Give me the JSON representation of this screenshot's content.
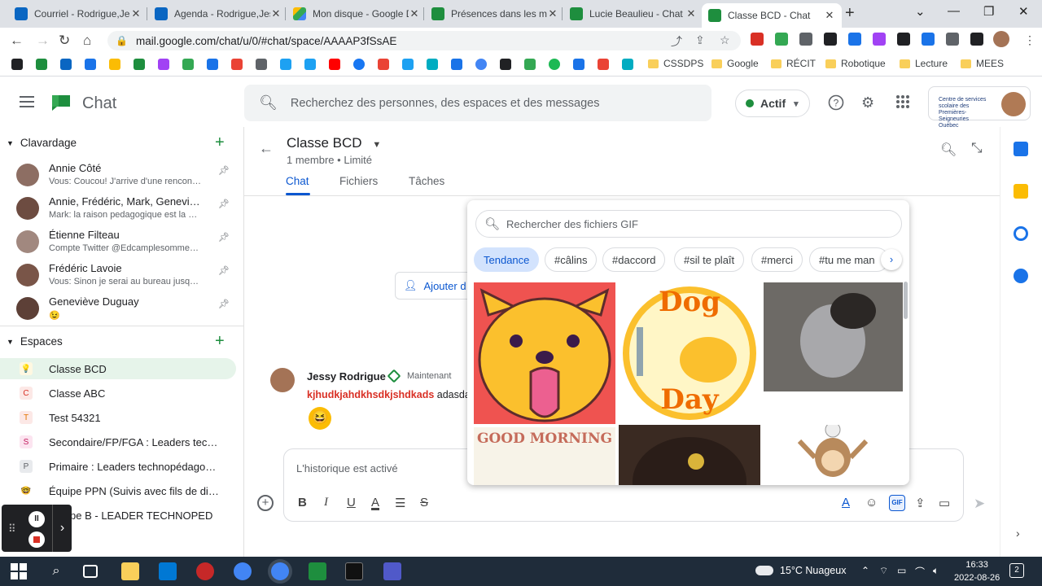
{
  "browser": {
    "tabs": [
      {
        "title": "Courriel - Rodrigue,Jes",
        "color": "#0a66c2"
      },
      {
        "title": "Agenda - Rodrigue,Jess",
        "color": "#0a66c2"
      },
      {
        "title": "Mon disque - Google D",
        "color": "#fbbc04"
      },
      {
        "title": "Présences dans les mi",
        "color": "#1e8e3e"
      },
      {
        "title": "Lucie Beaulieu - Chat",
        "color": "#1e8e3e"
      },
      {
        "title": "Classe BCD - Chat",
        "color": "#1e8e3e"
      }
    ],
    "new_tab": "+",
    "window_buttons": [
      "⌄",
      "—",
      "❐",
      "✕"
    ],
    "url": "mail.google.com/chat/u/0/#chat/space/AAAAP3fSsAE",
    "bookmark_folders": [
      "CSSDPS",
      "Google",
      "RÉCIT",
      "Robotique",
      "Lecture",
      "MEES"
    ]
  },
  "app": {
    "title": "Chat",
    "search_placeholder": "Recherchez des personnes, des espaces et des messages",
    "status": "Actif",
    "status_caret": "▾",
    "org_name": "Centre de services scolaire des Premières-Seigneuries Québec"
  },
  "sidebar": {
    "dm_header": "Clavardage",
    "dms": [
      {
        "name": "Annie Côté",
        "preview": "Vous: Coucou! J'arrive d'une rencon…",
        "color": "#8d6e63"
      },
      {
        "name": "Annie, Frédéric, Mark, Genevi…",
        "preview": "Mark: la raison pedagogique est la …",
        "color": "#6d4c41"
      },
      {
        "name": "Étienne Filteau",
        "preview": "Compte Twitter @Edcamplesomme…",
        "color": "#a1887f"
      },
      {
        "name": "Frédéric Lavoie",
        "preview": "Vous: Sinon je serai au bureau jusq…",
        "color": "#795548"
      },
      {
        "name": "Geneviève Duguay",
        "preview": "😉",
        "color": "#5d4037"
      }
    ],
    "spaces_header": "Espaces",
    "spaces": [
      {
        "label": "Classe BCD",
        "icon": "💡",
        "bg": "#fff8e1",
        "fg": "#f9ab00"
      },
      {
        "label": "Classe ABC",
        "icon": "C",
        "bg": "#fce8e6",
        "fg": "#d93025"
      },
      {
        "label": "Test 54321",
        "icon": "T",
        "bg": "#fce8e6",
        "fg": "#e37400"
      },
      {
        "label": "Secondaire/FP/FGA : Leaders tec…",
        "icon": "S",
        "bg": "#fce4f0",
        "fg": "#c2185b"
      },
      {
        "label": "Primaire : Leaders technopédago…",
        "icon": "P",
        "bg": "#e8eaed",
        "fg": "#5f6368"
      },
      {
        "label": "Équipe PPN (Suivis avec fils de di…",
        "icon": "🤓",
        "bg": "#fff",
        "fg": "#000"
      },
      {
        "label": "Équipe B - LEADER TECHNOPED",
        "icon": "É",
        "bg": "#e6f4ea",
        "fg": "#1e8e3e"
      }
    ]
  },
  "space": {
    "title": "Classe BCD",
    "members": "1 membre",
    "separator": "•",
    "access": "Limité",
    "tabs": [
      "Chat",
      "Fichiers",
      "Tâches"
    ],
    "add_button": "Ajouter d",
    "message": {
      "author": "Jessy Rodrigue",
      "time": "Maintenant",
      "text_red": "kjhudkjahdkhsdkjshdkads",
      "text": " adasda"
    },
    "composer_placeholder": "L'historique est activé"
  },
  "gif_picker": {
    "search_placeholder": "Rechercher des fichiers GIF",
    "chips": [
      "Tendance",
      "#câlins",
      "#daccord",
      "#sil te plaît",
      "#merci",
      "#tu me man"
    ],
    "gif_texts": {
      "dog_day_1": "Dog",
      "dog_day_2": "Day",
      "good_morning": "GOOD MORNING"
    }
  },
  "screen_share": {
    "pause": "II"
  },
  "taskbar": {
    "weather": "15°C  Nuageux",
    "time": "16:33",
    "date": "2022-08-26",
    "notifications": "2"
  }
}
